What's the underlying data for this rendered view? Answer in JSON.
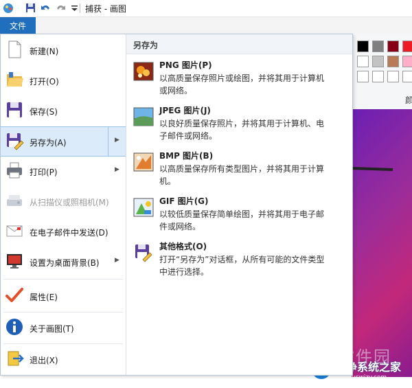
{
  "titlebar": {
    "title": "捕获 - 画图"
  },
  "tabs": {
    "file": "文件"
  },
  "menu": {
    "items": [
      {
        "label": "新建(N)"
      },
      {
        "label": "打开(O)"
      },
      {
        "label": "保存(S)"
      },
      {
        "label": "另存为(A)"
      },
      {
        "label": "打印(P)"
      },
      {
        "label": "从扫描仪或照相机(M)"
      },
      {
        "label": "在电子邮件中发送(D)"
      },
      {
        "label": "设置为桌面背景(B)"
      },
      {
        "label": "属性(E)"
      },
      {
        "label": "关于画图(T)"
      },
      {
        "label": "退出(X)"
      }
    ]
  },
  "save_as": {
    "header": "另存为",
    "formats": [
      {
        "name": "PNG 图片(P)",
        "desc": "以高质量保存照片或绘图，并将其用于计算机或网络。"
      },
      {
        "name": "JPEG 图片(J)",
        "desc": "以良好质量保存照片，并将其用于计算机、电子邮件或网络。"
      },
      {
        "name": "BMP 图片(B)",
        "desc": "以高质量保存所有类型图片，并将其用于计算机。"
      },
      {
        "name": "GIF 图片(G)",
        "desc": "以较低质量保存简单绘图，并将其用于电子邮件或网络。"
      },
      {
        "name": "其他格式(O)",
        "desc": "打开“另存为”对话框，从所有可能的文件类型中进行选择。"
      }
    ]
  },
  "background": {
    "ribbon_char": "颜",
    "watermark": "当下软件园",
    "brand_name": "纯净系统之家",
    "brand_url": "www.ycwjzy.com"
  },
  "colors": {
    "accent": "#1f6fbe",
    "menu_active": "#dcebfa",
    "palette": [
      "#000000",
      "#7f7f7f",
      "#880015",
      "#ed1c24",
      "#ffffff",
      "#c3c3c3",
      "#b97a57",
      "#ffaec9"
    ]
  }
}
